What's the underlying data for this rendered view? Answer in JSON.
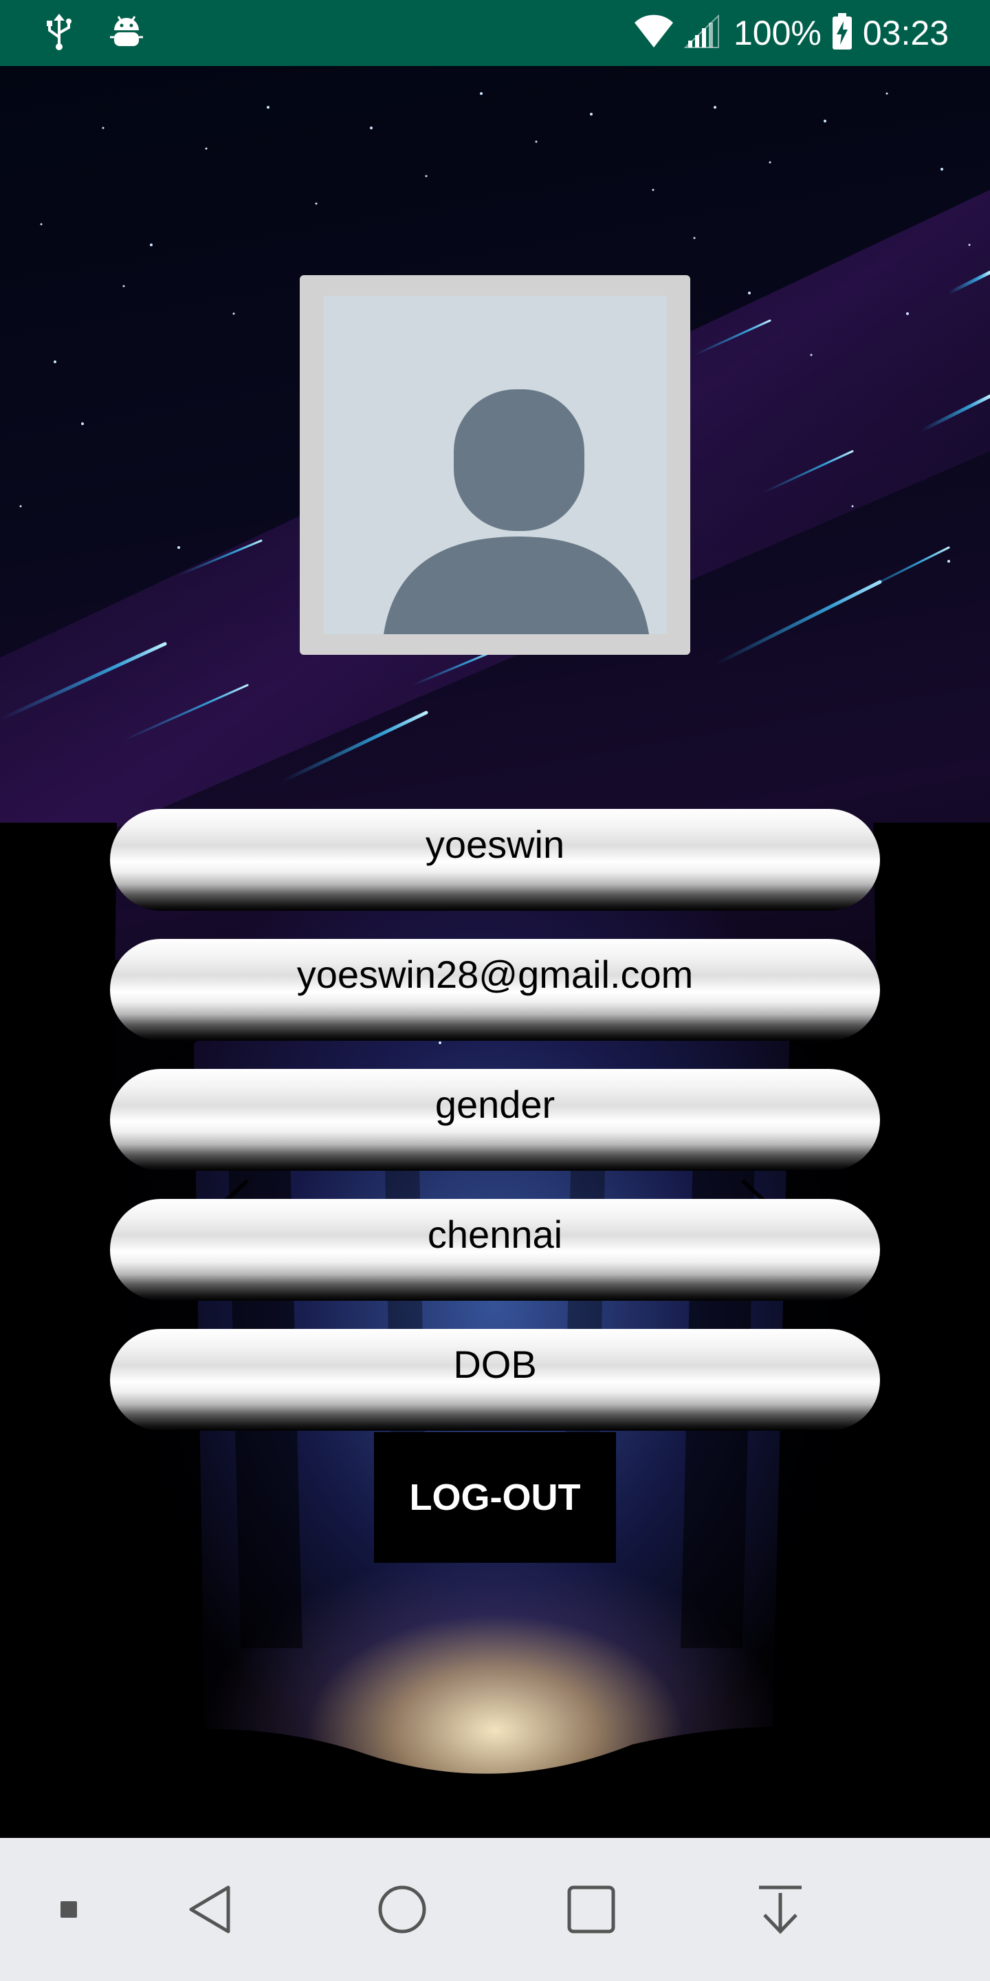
{
  "status_bar": {
    "left_icons": [
      "usb-icon",
      "android-debug-icon"
    ],
    "right_icons": [
      "wifi-icon",
      "signal-icon",
      "battery-charging-icon"
    ],
    "battery": "100%",
    "time": "03:23",
    "background": "#005f4b"
  },
  "profile": {
    "avatar_icon": "person-placeholder-icon",
    "fields": {
      "name": "yoeswin",
      "email": "yoeswin28@gmail.com",
      "gender": "gender",
      "city": "chennai",
      "dob": "DOB"
    },
    "logout_label": "LOG-OUT"
  },
  "nav_bar": {
    "items": [
      "menu-square-icon",
      "back-icon",
      "home-icon",
      "recents-icon",
      "download-icon"
    ],
    "background": "#e9ebee"
  },
  "colors": {
    "avatar_frame": "#d2d2d2",
    "avatar_bg": "#cfd9df",
    "avatar_silhouette": "#687886",
    "accent_streak": "#27b2ff"
  }
}
